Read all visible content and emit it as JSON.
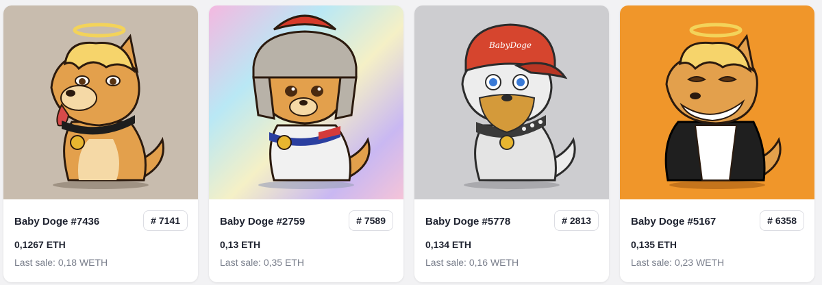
{
  "cards": [
    {
      "name": "Baby Doge #7436",
      "rank": "# 7141",
      "price": "0,1267 ETH",
      "last_sale": "Last sale: 0,18 WETH",
      "background": "#c8bcae",
      "traits": [
        "halo",
        "blonde-hair",
        "tongue-out",
        "black-collar",
        "gold-medal"
      ]
    },
    {
      "name": "Baby Doge #2759",
      "rank": "# 7589",
      "price": "0,13 ETH",
      "last_sale": "Last sale: 0,35 ETH",
      "background": "holographic",
      "traits": [
        "roman-helmet",
        "white-jacket",
        "gold-medal"
      ]
    },
    {
      "name": "Baby Doge #5778",
      "rank": "# 2813",
      "price": "0,134 ETH",
      "last_sale": "Last sale: 0,16 WETH",
      "background": "#cdcdd0",
      "traits": [
        "red-cap",
        "beard",
        "blue-eyes",
        "spiked-collar",
        "gold-medal"
      ],
      "cap_text": "BabyDoge"
    },
    {
      "name": "Baby Doge #5167",
      "rank": "# 6358",
      "price": "0,135 ETH",
      "last_sale": "Last sale: 0,23 WETH",
      "background": "#f0962a",
      "traits": [
        "halo",
        "blonde-hair",
        "grin",
        "black-jacket"
      ]
    }
  ]
}
